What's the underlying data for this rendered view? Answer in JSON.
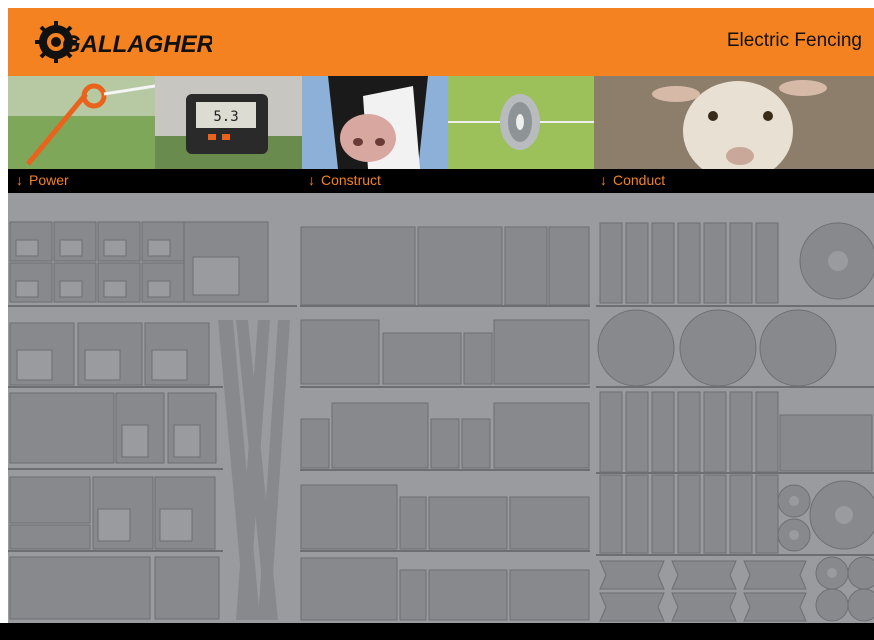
{
  "header": {
    "brand": "GALLAGHER",
    "tagline": "Electric Fencing",
    "brand_color": "#f58220"
  },
  "photos": [
    {
      "subject": "orange pigtail fence post"
    },
    {
      "subject": "digital fence tester"
    },
    {
      "subject": "cow"
    },
    {
      "subject": "insulator on wire"
    },
    {
      "subject": "sheep"
    }
  ],
  "nav": {
    "items": [
      {
        "label": "Power",
        "icon": "arrow-down-icon"
      },
      {
        "label": "Construct",
        "icon": "arrow-down-icon"
      },
      {
        "label": "Conduct",
        "icon": "arrow-down-icon"
      }
    ]
  },
  "shelving": {
    "sections": [
      "power",
      "construct",
      "conduct"
    ],
    "fill": "#9a9b9e",
    "shape_fill": "#808186",
    "line_color": "#6d6e72"
  }
}
